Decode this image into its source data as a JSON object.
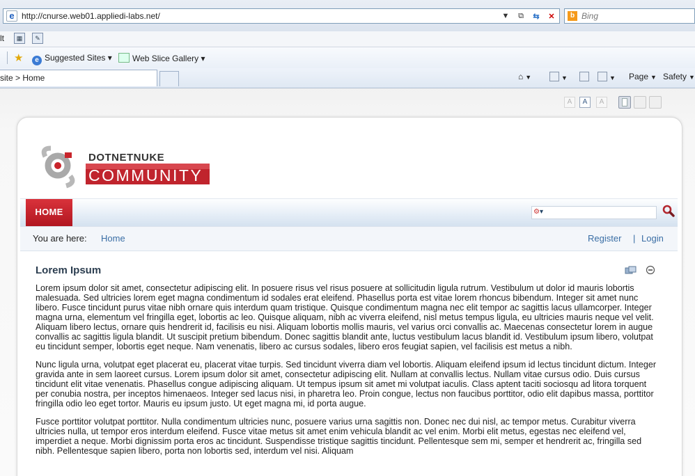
{
  "browser": {
    "address_url": "http://cnurse.web01.appliedi-labs.net/",
    "search_placeholder": "Bing",
    "menu_text": "lt",
    "favorites": {
      "suggested_sites": "Suggested Sites",
      "web_slice_gallery": "Web Slice Gallery"
    },
    "tab_title": "site > Home",
    "commands": {
      "page": "Page",
      "safety": "Safety"
    }
  },
  "page": {
    "logo": {
      "top": "DOTNETNUKE",
      "bottom": "COMMUNITY"
    },
    "nav": {
      "home": "HOME"
    },
    "breadcrumb": {
      "label": "You are here:",
      "home": "Home"
    },
    "user": {
      "register": "Register",
      "separator": "|",
      "login": "Login"
    },
    "font_size_glyph": "A",
    "module": {
      "title": "Lorem Ipsum",
      "paragraphs": [
        "Lorem ipsum dolor sit amet, consectetur adipiscing elit. In posuere risus vel risus posuere at sollicitudin ligula rutrum. Vestibulum ut dolor id mauris lobortis malesuada. Sed ultricies lorem eget magna condimentum id sodales erat eleifend. Phasellus porta est vitae lorem rhoncus bibendum. Integer sit amet nunc libero. Fusce tincidunt purus vitae nibh ornare quis interdum quam tristique. Quisque condimentum magna nec elit tempor ac sagittis lacus ullamcorper. Integer magna urna, elementum vel fringilla eget, lobortis ac leo. Quisque aliquam, nibh ac viverra eleifend, nisl metus tempus ligula, eu ultricies mauris neque vel velit. Aliquam libero lectus, ornare quis hendrerit id, facilisis eu nisi. Aliquam lobortis mollis mauris, vel varius orci convallis ac. Maecenas consectetur lorem in augue convallis ac sagittis ligula blandit. Ut suscipit pretium bibendum. Donec sagittis blandit ante, luctus vestibulum lacus blandit id. Vestibulum ipsum libero, volutpat eu tincidunt semper, lobortis eget neque. Nam venenatis, libero ac cursus sodales, libero eros feugiat sapien, vel facilisis est metus a nibh.",
        "Nunc ligula urna, volutpat eget placerat eu, placerat vitae turpis. Sed tincidunt viverra diam vel lobortis. Aliquam eleifend ipsum id lectus tincidunt dictum. Integer gravida ante in sem laoreet cursus. Lorem ipsum dolor sit amet, consectetur adipiscing elit. Nullam at convallis lectus. Nullam vitae cursus odio. Duis cursus tincidunt elit vitae venenatis. Phasellus congue adipiscing aliquam. Ut tempus ipsum sit amet mi volutpat iaculis. Class aptent taciti sociosqu ad litora torquent per conubia nostra, per inceptos himenaeos. Integer sed lacus nisi, in pharetra leo. Proin congue, lectus non faucibus porttitor, odio elit dapibus massa, porttitor fringilla odio leo eget tortor. Mauris eu ipsum justo. Ut eget magna mi, id porta augue.",
        "Fusce porttitor volutpat porttitor. Nulla condimentum ultricies nunc, posuere varius urna sagittis non. Donec nec dui nisl, ac tempor metus. Curabitur viverra ultricies nulla, ut tempor eros interdum eleifend. Fusce vitae metus sit amet enim vehicula blandit ac vel enim. Morbi elit metus, egestas nec eleifend vel, imperdiet a neque. Morbi dignissim porta eros ac tincidunt. Suspendisse tristique sagittis tincidunt. Pellentesque sem mi, semper et hendrerit ac, fringilla sed nibh. Pellentesque sapien libero, porta non lobortis sed, interdum vel nisi. Aliquam"
      ]
    }
  },
  "colors": {
    "brand_red": "#c0242d",
    "link_blue": "#3a6ea5"
  },
  "icons": [
    "ie-page-icon",
    "compat-view-icon",
    "refresh-icon",
    "stop-icon",
    "bing-icon",
    "favorites-star-icon",
    "home-icon",
    "rss-icon",
    "mail-icon",
    "print-icon",
    "search-icon",
    "module-action-icon",
    "minimize-icon"
  ]
}
